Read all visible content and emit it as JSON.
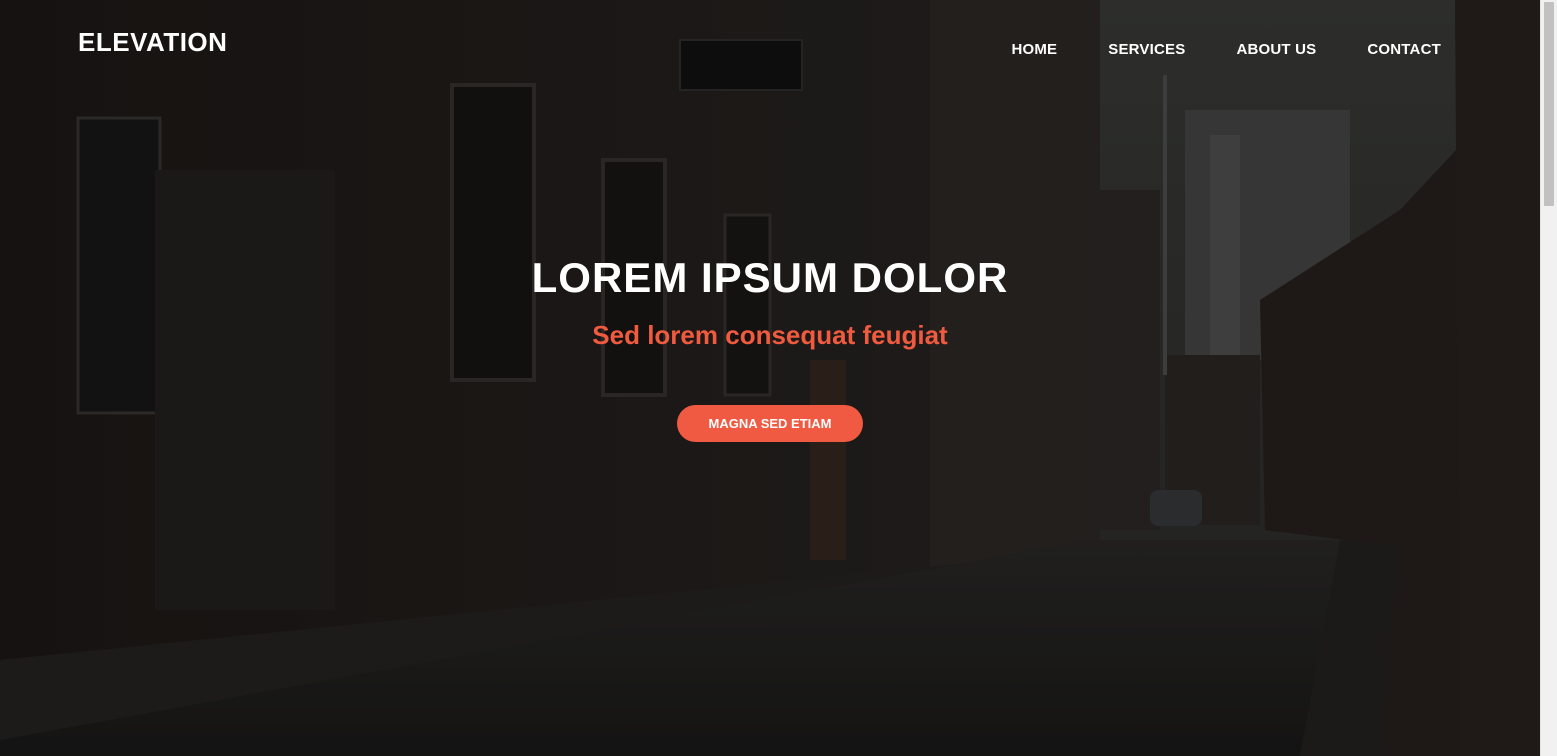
{
  "header": {
    "logo": "ELEVATION",
    "nav": [
      "HOME",
      "SERVICES",
      "ABOUT US",
      "CONTACT"
    ]
  },
  "hero": {
    "title": "LOREM IPSUM DOLOR",
    "subtitle": "Sed lorem consequat feugiat",
    "cta_label": "MAGNA SED ETIAM"
  },
  "colors": {
    "accent": "#f15a42",
    "text": "#ffffff"
  }
}
